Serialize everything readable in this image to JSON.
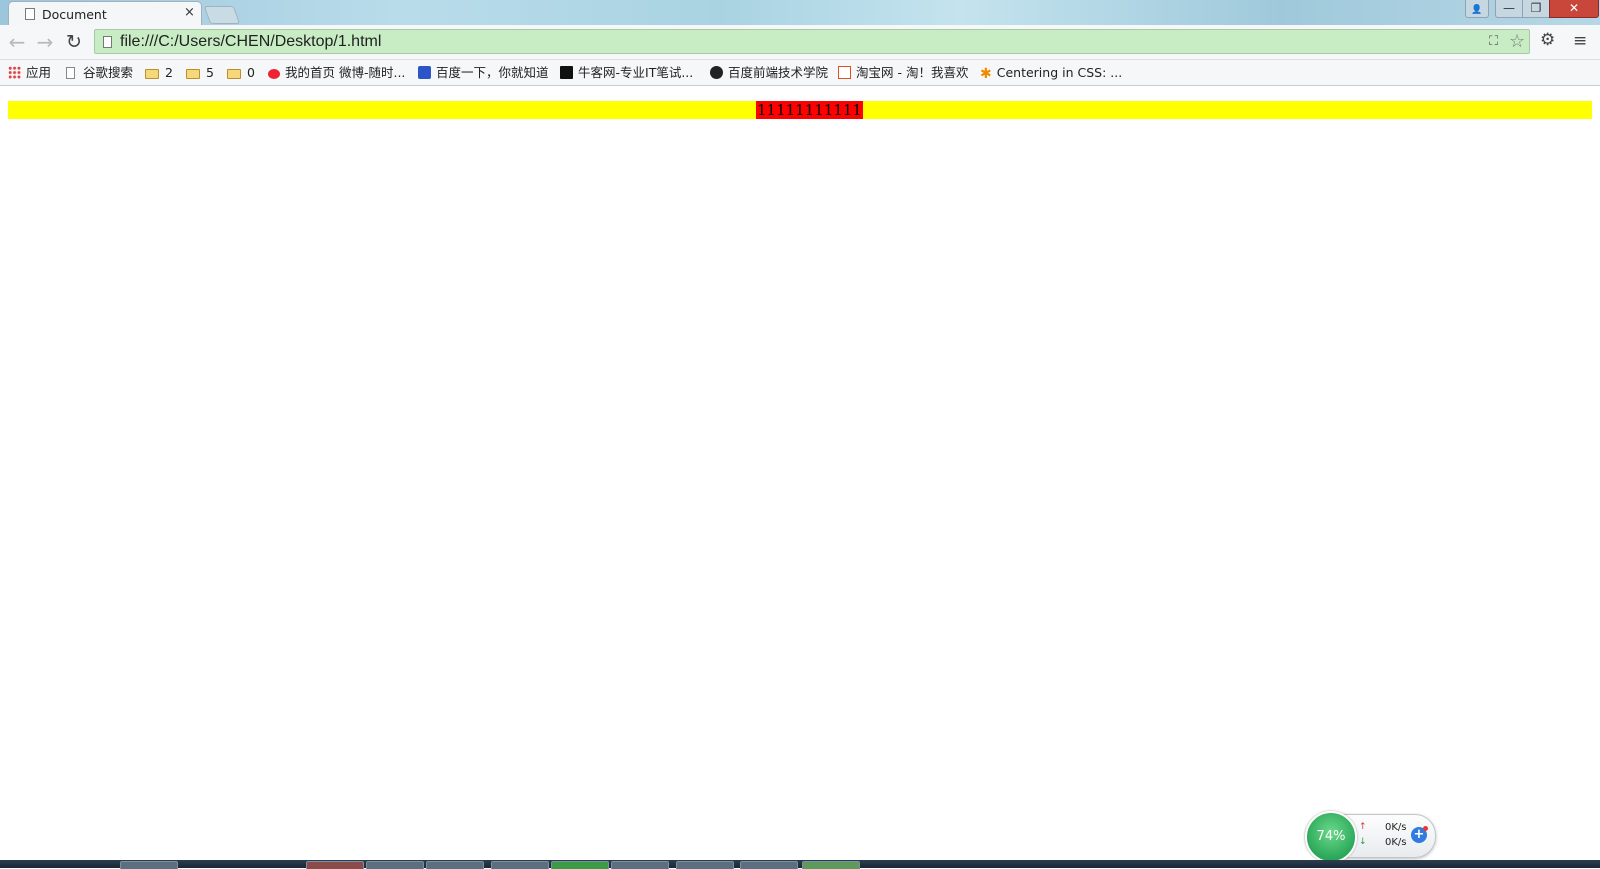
{
  "browser": {
    "tab": {
      "title": "Document",
      "close_glyph": "×"
    },
    "window_controls": {
      "user_glyph": "👤",
      "minimize_glyph": "—",
      "maximize_glyph": "❐",
      "close_glyph": "✕"
    },
    "toolbar": {
      "back_glyph": "←",
      "forward_glyph": "→",
      "reload_glyph": "↻",
      "url": "file:///C:/Users/CHEN/Desktop/1.html",
      "translate_glyph": "⛶",
      "star_glyph": "☆",
      "extension_glyph": "⚙",
      "menu_glyph": "≡"
    },
    "bookmarks": [
      {
        "label": "应用",
        "icon": "apps-icon"
      },
      {
        "label": "谷歌搜索",
        "icon": "page-icon"
      },
      {
        "label": "2",
        "icon": "folder-icon"
      },
      {
        "label": "5",
        "icon": "folder-icon"
      },
      {
        "label": "0",
        "icon": "folder-icon"
      },
      {
        "label": "我的首页 微博-随时...",
        "icon": "weibo-icon"
      },
      {
        "label": "百度一下，你就知道",
        "icon": "baidu-icon"
      },
      {
        "label": "牛客网-专业IT笔试...",
        "icon": "nowcoder-icon"
      },
      {
        "label": "百度前端技术学院",
        "icon": "ife-icon"
      },
      {
        "label": "淘宝网 - 淘！我喜欢",
        "icon": "taobao-icon"
      },
      {
        "label": "Centering in CSS: ...",
        "icon": "star-icon"
      }
    ]
  },
  "page": {
    "bar_color": "#ffff00",
    "box_color": "#ff0000",
    "box_text": "11111111111"
  },
  "net_widget": {
    "percent": "74%",
    "up_arrow": "↑",
    "down_arrow": "↓",
    "upload": "0K/s",
    "download": "0K/s",
    "plus": "+"
  }
}
